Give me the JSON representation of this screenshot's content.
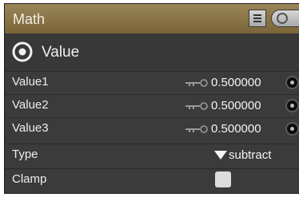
{
  "node": {
    "title": "Math",
    "header_buttons": [
      "list-icon",
      "sphere-preview-icon"
    ]
  },
  "section": {
    "icon": "output-target-icon",
    "label": "Value"
  },
  "inputs": [
    {
      "label": "Value1",
      "value": "0.500000"
    },
    {
      "label": "Value2",
      "value": "0.500000"
    },
    {
      "label": "Value3",
      "value": "0.500000"
    }
  ],
  "type_field": {
    "label": "Type",
    "selected": "subtract"
  },
  "clamp_field": {
    "label": "Clamp",
    "checked": false
  },
  "colors": {
    "header": "#8a7547",
    "panel": "#3a3a3a",
    "text": "#f0f0f0"
  }
}
